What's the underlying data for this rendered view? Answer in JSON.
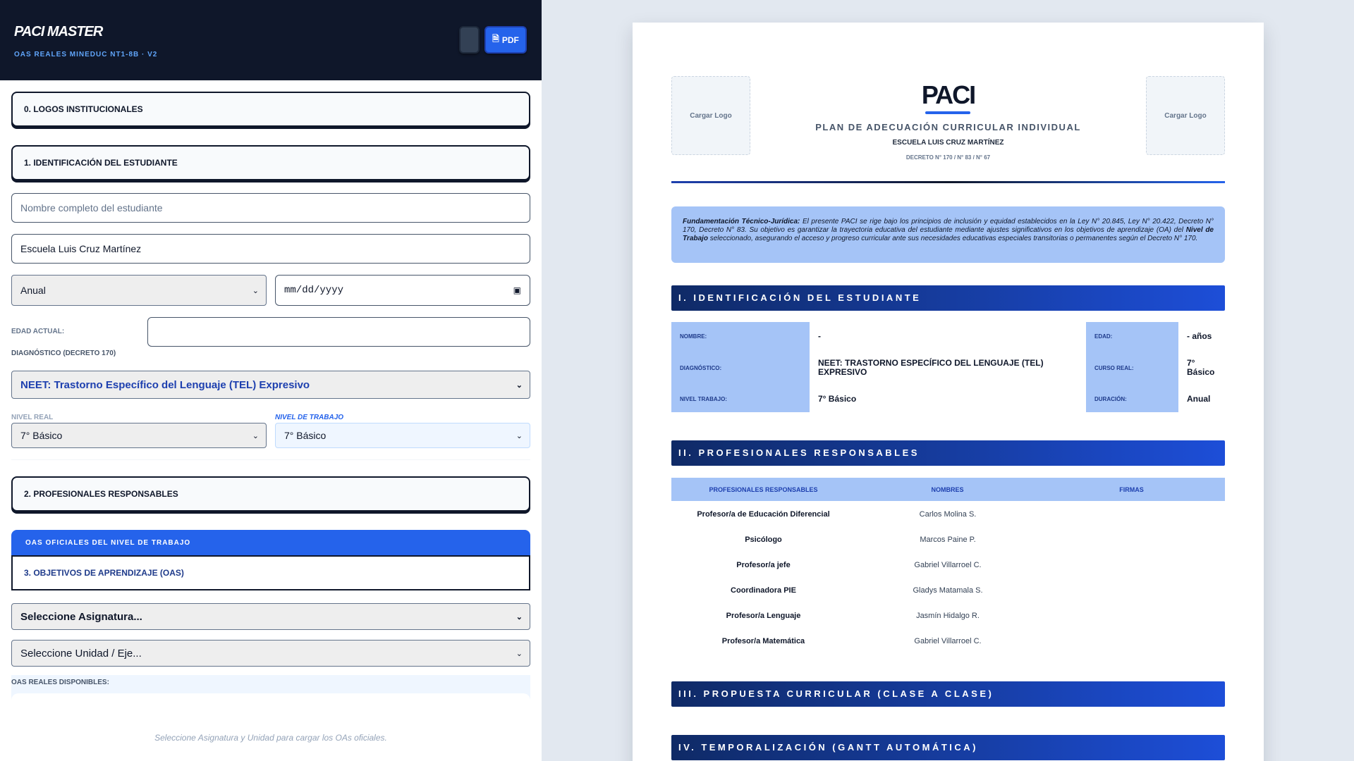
{
  "app": {
    "title": "PACI MASTER",
    "subtitle": "OAS REALES MINEDUC NT1-8B · V2",
    "icon_button_glyph": "",
    "pdf_button_label": "PDF",
    "pdf_button_icon": "pdf-icon"
  },
  "form": {
    "sections": {
      "logos": "0. LOGOS INSTITUCIONALES",
      "identificacion": "1. IDENTIFICACIÓN DEL ESTUDIANTE",
      "profesionales": "2. PROFESIONALES RESPONSABLES",
      "oas": "3. OBJETIVOS DE APRENDIZAJE (OAS)"
    },
    "chevron": "",
    "student_name": {
      "value": "",
      "placeholder": "Nombre completo del estudiante"
    },
    "school": {
      "value": "Escuela Luis Cruz Martínez"
    },
    "duracion": {
      "value": "Anual"
    },
    "fecha": {
      "value": "mm/dd/yyyy"
    },
    "edad_label": "EDAD ACTUAL:",
    "edad_value": "",
    "diagnostico_label": "DIAGNÓSTICO (DECRETO 170)",
    "diagnostico_value": "NEET: Trastorno Específico del Lenguaje (TEL) Expresivo",
    "nivel_real_label": "NIVEL REAL",
    "nivel_real_value": "7° Básico",
    "nivel_trabajo_label": "NIVEL DE TRABAJO",
    "nivel_trabajo_value": "7° Básico",
    "oas_header": "OAS OFICIALES DEL NIVEL DE TRABAJO",
    "oas_header_icon": "",
    "asignatura": {
      "value": "Seleccione Asignatura..."
    },
    "unidad": {
      "value": "Seleccione Unidad / Eje..."
    },
    "oas_disponibles_label": "OAS REALES DISPONIBLES:",
    "oas_empty_text": "Seleccione Asignatura y Unidad para cargar los OAs oficiales."
  },
  "doc": {
    "logo_placeholder": "Cargar Logo",
    "title": "PACI",
    "plan": "PLAN DE ADECUACIÓN CURRICULAR INDIVIDUAL",
    "school": "ESCUELA LUIS CRUZ MARTÍNEZ",
    "decreto": "DECRETO N° 170 / N° 83 / N° 67",
    "fund_title": "Fundamentación Técnico-Jurídica:",
    "fund_text_1": "El presente PACI se rige bajo los principios de inclusión y equidad establecidos en la Ley N° 20.845, Ley N° 20.422, Decreto N° 170, Decreto N° 83. Su objetivo es garantizar la trayectoria educativa del estudiante mediante ajustes significativos en los objetivos de aprendizaje (OA) del",
    "fund_bold": "Nivel de Trabajo",
    "fund_text_2": "seleccionado, asegurando el acceso y progreso curricular ante sus necesidades educativas especiales transitorias o permanentes según el Decreto N° 170.",
    "sections": {
      "s1": "I. IDENTIFICACIÓN DEL ESTUDIANTE",
      "s2": "II. PROFESIONALES RESPONSABLES",
      "s3": "III. PROPUESTA CURRICULAR (CLASE A CLASE)",
      "s4": "IV. TEMPORALIZACIÓN (GANTT AUTOMÁTICA)"
    },
    "ident": {
      "nombre_label": "NOMBRE:",
      "nombre_value": "-",
      "edad_label": "EDAD:",
      "edad_value": "- años",
      "diag_label": "DIAGNÓSTICO:",
      "diag_value": "NEET: TRASTORNO ESPECÍFICO DEL LENGUAJE (TEL) EXPRESIVO",
      "curso_label": "CURSO REAL:",
      "curso_value": "7° Básico",
      "nivel_label": "NIVEL TRABAJO:",
      "nivel_value": "7° Básico",
      "duracion_label": "DURACIÓN:",
      "duracion_value": "Anual"
    },
    "prof_headers": [
      "PROFESIONALES RESPONSABLES",
      "NOMBRES",
      "FIRMAS"
    ],
    "profesionales": [
      {
        "role": "Profesor/a de Educación Diferencial",
        "name": "Carlos Molina S."
      },
      {
        "role": "Psicólogo",
        "name": "Marcos Paine P."
      },
      {
        "role": "Profesor/a jefe",
        "name": "Gabriel Villarroel C."
      },
      {
        "role": "Coordinadora PIE",
        "name": "Gladys Matamala S."
      },
      {
        "role": "Profesor/a Lenguaje",
        "name": "Jasmín Hidalgo R."
      },
      {
        "role": "Profesor/a Matemática",
        "name": "Gabriel Villarroel C."
      }
    ]
  }
}
